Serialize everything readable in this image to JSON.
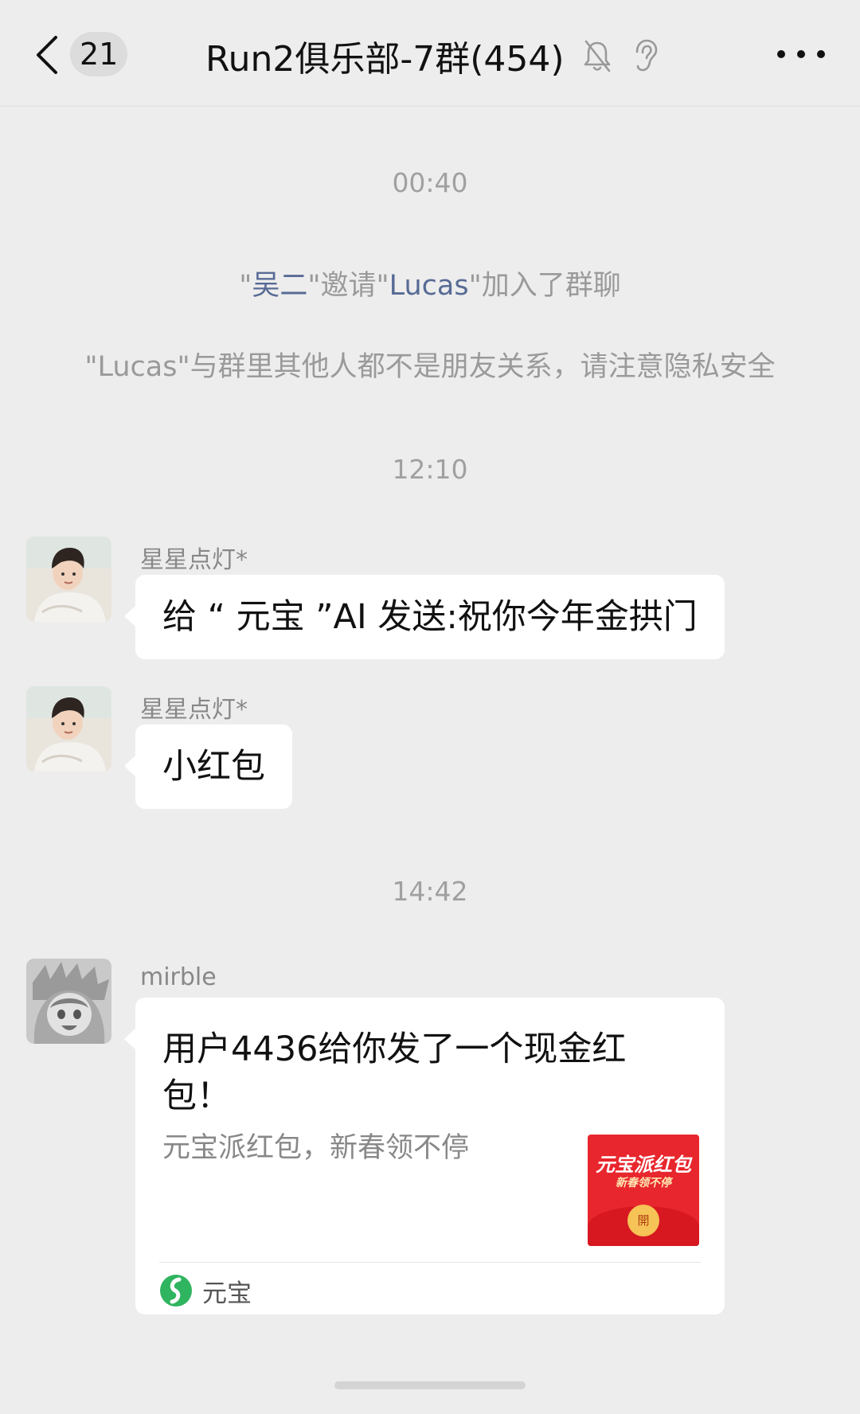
{
  "header": {
    "unread_count": "21",
    "title": "Run2俱乐部-7群(454)"
  },
  "messages_area": {
    "timestamps": [
      "00:40",
      "12:10",
      "14:42"
    ],
    "system_invite": {
      "q1": "\"",
      "inviter": "吴二",
      "mid": "\"邀请\"",
      "invitee": "Lucas",
      "tail": "\"加入了群聊"
    },
    "privacy_notice": "\"Lucas\"与群里其他人都不是朋友关系，请注意隐私安全",
    "messages": [
      {
        "sender": "星星点灯*",
        "text": "给 “ 元宝 ”AI 发送:祝你今年金拱门"
      },
      {
        "sender": "星星点灯*",
        "text": "小红包"
      }
    ],
    "card_message": {
      "sender": "mirble",
      "title": "用户4436给你发了一个现金红包！",
      "description": "元宝派红包，新春领不停",
      "thumb_main": "元宝派红包",
      "thumb_sub": "新春领不停",
      "thumb_open": "開",
      "source": "元宝"
    }
  },
  "colors": {
    "background": "#ededed",
    "bubble": "#ffffff",
    "link": "#576b95",
    "red_packet": "#e8262d",
    "yuanbao_green": "#2fb45f"
  },
  "icons": [
    "back-arrow-icon",
    "mute-bell-icon",
    "ear-icon",
    "more-icon",
    "yuanbao-logo-icon"
  ]
}
